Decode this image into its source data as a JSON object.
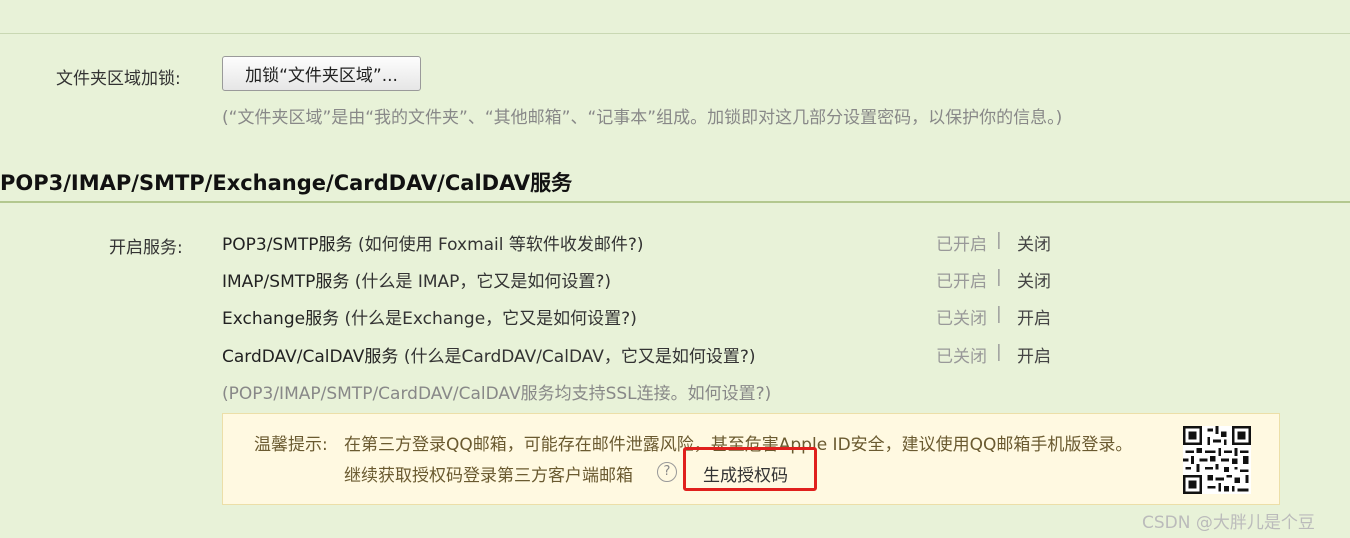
{
  "folder_lock": {
    "label": "文件夹区域加锁:",
    "button": "加锁“文件夹区域”...",
    "note": "(“文件夹区域”是由“我的文件夹”、“其他邮箱”、“记事本”组成。加锁即对这几部分设置密码，以保护你的信息。)"
  },
  "services_section": {
    "title": "POP3/IMAP/SMTP/Exchange/CardDAV/CalDAV服务",
    "label": "开启服务:",
    "rows": [
      {
        "name": "POP3/SMTP服务",
        "help": "(如何使用 Foxmail 等软件收发邮件?)",
        "state": "已开启",
        "sep": "|",
        "action": "关闭"
      },
      {
        "name": "IMAP/SMTP服务",
        "help": "(什么是 IMAP，它又是如何设置?)",
        "state": "已开启",
        "sep": "|",
        "action": "关闭"
      },
      {
        "name": "Exchange服务",
        "help": "(什么是Exchange，它又是如何设置?)",
        "state": "已关闭",
        "sep": "|",
        "action": "开启"
      },
      {
        "name": "CardDAV/CalDAV服务",
        "help": "(什么是CardDAV/CalDAV，它又是如何设置?)",
        "state": "已关闭",
        "sep": "|",
        "action": "开启"
      }
    ],
    "ssl_note": "(POP3/IMAP/SMTP/CardDAV/CalDAV服务均支持SSL连接。如何设置?)"
  },
  "tip": {
    "label": "温馨提示:",
    "line1": "在第三方登录QQ邮箱，可能存在邮件泄露风险，甚至危害Apple ID安全，建议使用QQ邮箱手机版登录。",
    "line2": "继续获取授权码登录第三方客户端邮箱",
    "help_glyph": "?",
    "generate_button": "生成授权码",
    "qr_icon": "qr-code"
  },
  "watermark": "CSDN @大胖儿是个豆",
  "colors": {
    "background": "#e8f2d8",
    "highlight": "#e0201d",
    "tip_background": "#fff9e1"
  }
}
